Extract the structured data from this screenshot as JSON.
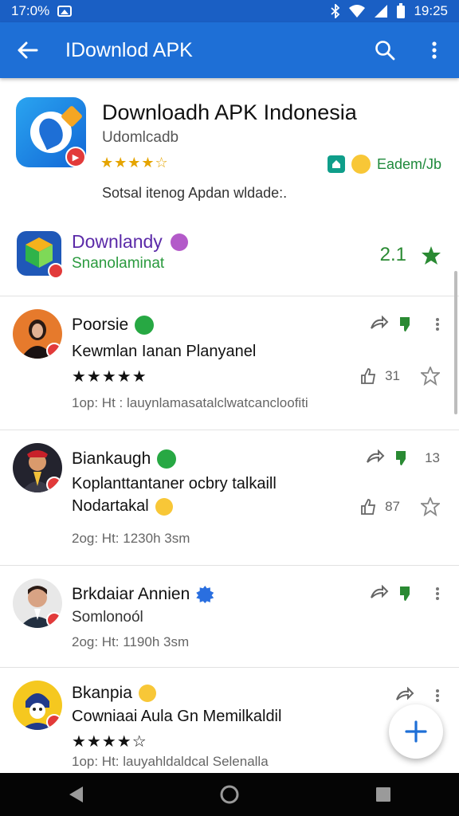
{
  "statusbar": {
    "time_left": "17:0%",
    "time_right": "19:25"
  },
  "appbar": {
    "title": "IDownlod APK"
  },
  "header": {
    "name": "Downloadh APK Indonesia",
    "subtitle": "Udomlcadb",
    "rating_stars": "★★★★☆",
    "developer": "Eadem/Jb",
    "description": "Sotsal itenog Apdan wldade:."
  },
  "featured": {
    "name": "Downlandy",
    "subtitle": "Snanolaminat",
    "score": "2.1"
  },
  "reviews": [
    {
      "name": "Poorsie",
      "text": "Kewmlan Ianan Planyanel",
      "stars": "★★★★★",
      "meta": "1op: Ht : lauynlamasatalclwatcancloofiti",
      "count": "31"
    },
    {
      "name": "Biankaugh",
      "text_line1": "Koplanttantaner ocbry talkaill",
      "text_line2": "Nodartakal",
      "meta": "2og: Ht: 1230h 3sm",
      "count_top": "13",
      "count": "87"
    },
    {
      "name": "Brkdaiar Annien",
      "text": "Somlonoól",
      "meta": "2og: Ht: 1190h 3sm"
    },
    {
      "name": "Bkanpia",
      "text": "Cowniaai Aula Gn Memilkaldil",
      "stars": "★★★★☆",
      "meta": "1op: Ht: lauyahldaldcal Selenalla"
    }
  ],
  "colors": {
    "appbar": "#1e6fd6",
    "statusbar": "#1a5fc4",
    "star": "#e5a400",
    "green": "#2a8a33",
    "purple": "#5b2aa8"
  }
}
